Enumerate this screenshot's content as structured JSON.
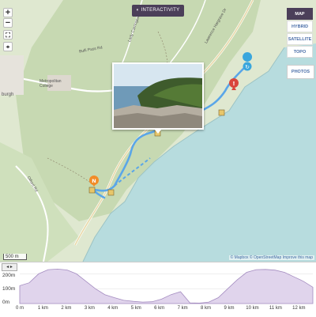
{
  "top_bar": {
    "interactivity_label": "INTERACTIVITY"
  },
  "zoom": {
    "zoom_in": "+",
    "zoom_out": "−"
  },
  "layers": [
    "MAP",
    "HYBRID",
    "SATELLITE",
    "TOPO"
  ],
  "active_layer": "MAP",
  "photos_label": "PHOTOS",
  "map_labels": {
    "suburb": "burgh",
    "college": "Metropolitan College",
    "road1": "Lawrence Hargrave Dr",
    "road2": "Otford Rd",
    "road3": "Lady Carrington Dr",
    "road4": "Bulli Pass Rd"
  },
  "scale_label": "500 m",
  "attribution": {
    "mapbox": "© Mapbox",
    "osm": "© OpenStreetMap",
    "improve": "Improve this map"
  },
  "elevation": {
    "toggle": "◂ ▸",
    "y_labels": [
      "200m",
      "100m",
      "0m"
    ],
    "x_labels": [
      "0 m",
      "1 km",
      "2 km",
      "3 km",
      "4 km",
      "5 km",
      "6 km",
      "7 km",
      "8 km",
      "9 km",
      "10 km",
      "11 km",
      "12 km"
    ],
    "profile_m": [
      120,
      140,
      200,
      228,
      232,
      226,
      200,
      150,
      100,
      60,
      40,
      22,
      15,
      10,
      12,
      30,
      60,
      80,
      5,
      3,
      10,
      40,
      100,
      160,
      210,
      228,
      230,
      225,
      210,
      180,
      150,
      110
    ],
    "colors": {
      "fill": "#e0d4ec",
      "stroke": "#a48cc0"
    }
  },
  "colors": {
    "route": "#5aa6e8",
    "sea": "#b7dcde",
    "land": "#dfe8d0",
    "forest": "#c7d9b2",
    "accent": "#4b3f59"
  },
  "icons": [
    "start-pin-icon",
    "end-pin-icon",
    "warning-icon",
    "food-icon",
    "camp-icon",
    "car-icon",
    "lookout-icon",
    "fullscreen-icon",
    "location-icon"
  ]
}
